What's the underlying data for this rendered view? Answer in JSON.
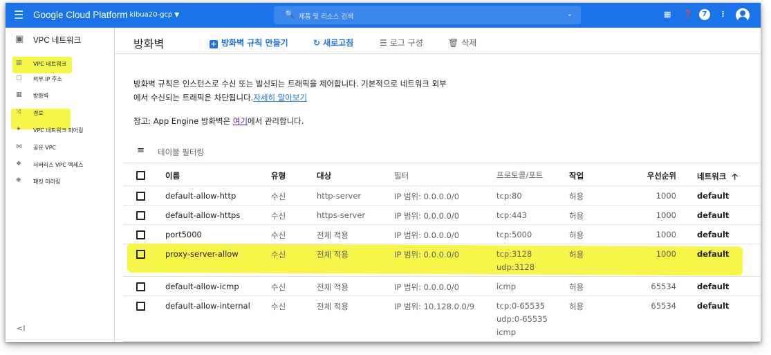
{
  "topbar": {
    "menu_icon": "hamburger-menu-icon",
    "title": "Google Cloud Platform",
    "project": "kibua20-gcp",
    "search_placeholder": "제품 및 리소스 검색",
    "icons": [
      "cloud-shell-icon",
      "help-icon",
      "notifications-badge",
      "more-vert-icon",
      "account-avatar-icon"
    ],
    "notification_count": "7"
  },
  "sidebar": {
    "header": "VPC 네트워크",
    "items": [
      {
        "label": "VPC 네트워크",
        "icon": "vpc-network-icon"
      },
      {
        "label": "외부 IP 주소",
        "icon": "external-ip-icon"
      },
      {
        "label": "방화벽",
        "icon": "firewall-icon",
        "active": true
      },
      {
        "label": "경로",
        "icon": "routes-icon"
      },
      {
        "label": "VPC 네트워크 피어링",
        "icon": "peering-icon"
      },
      {
        "label": "공유 VPC",
        "icon": "shared-vpc-icon"
      },
      {
        "label": "서버리스 VPC 액세스",
        "icon": "serverless-vpc-icon"
      },
      {
        "label": "패킷 미러링",
        "icon": "packet-mirroring-icon"
      }
    ],
    "collapse": "<I"
  },
  "page": {
    "title": "방화벽",
    "actions": {
      "create": "방화벽 규칙 만들기",
      "refresh": "새로고침",
      "logs": "로그 구성",
      "delete": "삭제"
    },
    "description_1": "방화벽 규칙은 인스턴스로 수신 또는 발신되는 트래픽을 제어합니다. 기본적으로 네트워크 외부",
    "description_2": "에서 수신되는 트래픽은 차단됩니다.",
    "learn_more": "자세히 알아보기",
    "note_prefix": "참고: App Engine 방화벽은 ",
    "note_link": "여기",
    "note_suffix": "에서 관리합니다.",
    "filter_label": "테이블 필터링"
  },
  "table": {
    "headers": {
      "name": "이름",
      "type": "유형",
      "target": "대상",
      "filter": "필터",
      "protocol": "프로토콜/포트",
      "action": "작업",
      "priority": "우선순위",
      "network": "네트워크",
      "sort_icon": "sort-ascending-arrow-icon"
    },
    "rows": [
      {
        "name": "default-allow-http",
        "type": "수신",
        "target": "http-server",
        "filter": "IP 범위: 0.0.0.0/0",
        "protocol": [
          "tcp:80"
        ],
        "action": "허용",
        "priority": "1000",
        "network": "default"
      },
      {
        "name": "default-allow-https",
        "type": "수신",
        "target": "https-server",
        "filter": "IP 범위: 0.0.0.0/0",
        "protocol": [
          "tcp:443"
        ],
        "action": "허용",
        "priority": "1000",
        "network": "default"
      },
      {
        "name": "port5000",
        "type": "수신",
        "target": "전체 적용",
        "filter": "IP 범위: 0.0.0.0/0",
        "protocol": [
          "tcp:5000"
        ],
        "action": "허용",
        "priority": "1000",
        "network": "default"
      },
      {
        "name": "proxy-server-allow",
        "type": "수신",
        "target": "전체 적용",
        "filter": "IP 범위: 0.0.0.0/0",
        "protocol": [
          "tcp:3128",
          "udp:3128"
        ],
        "action": "허용",
        "priority": "1000",
        "network": "default"
      },
      {
        "name": "default-allow-icmp",
        "type": "수신",
        "target": "전체 적용",
        "filter": "IP 범위: 0.0.0.0/0",
        "protocol": [
          "icmp"
        ],
        "action": "허용",
        "priority": "65534",
        "network": "default"
      },
      {
        "name": "default-allow-internal",
        "type": "수신",
        "target": "전체 적용",
        "filter": "IP 범위: 10.128.0.0/9",
        "protocol": [
          "tcp:0-65535",
          "udp:0-65535",
          "icmp"
        ],
        "action": "허용",
        "priority": "65534",
        "network": "default"
      }
    ]
  },
  "colors": {
    "brand_blue": "#1a73e8",
    "highlight_yellow": "#f5f528"
  }
}
